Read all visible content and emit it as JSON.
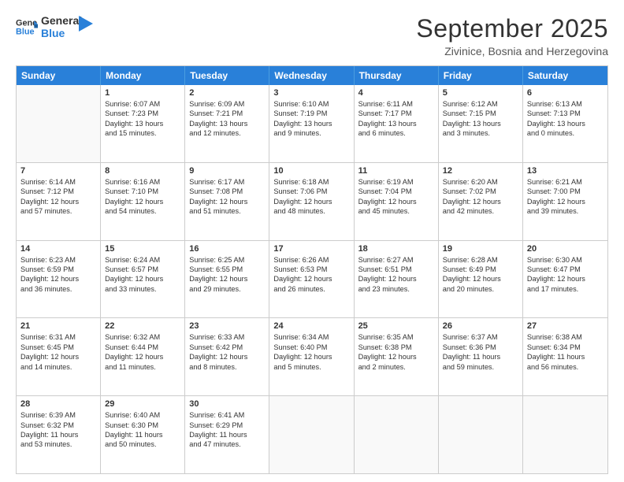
{
  "logo": {
    "line1": "General",
    "line2": "Blue"
  },
  "header": {
    "title": "September 2025",
    "subtitle": "Zivinice, Bosnia and Herzegovina"
  },
  "days": [
    "Sunday",
    "Monday",
    "Tuesday",
    "Wednesday",
    "Thursday",
    "Friday",
    "Saturday"
  ],
  "weeks": [
    [
      {
        "day": "",
        "lines": []
      },
      {
        "day": "1",
        "lines": [
          "Sunrise: 6:07 AM",
          "Sunset: 7:23 PM",
          "Daylight: 13 hours",
          "and 15 minutes."
        ]
      },
      {
        "day": "2",
        "lines": [
          "Sunrise: 6:09 AM",
          "Sunset: 7:21 PM",
          "Daylight: 13 hours",
          "and 12 minutes."
        ]
      },
      {
        "day": "3",
        "lines": [
          "Sunrise: 6:10 AM",
          "Sunset: 7:19 PM",
          "Daylight: 13 hours",
          "and 9 minutes."
        ]
      },
      {
        "day": "4",
        "lines": [
          "Sunrise: 6:11 AM",
          "Sunset: 7:17 PM",
          "Daylight: 13 hours",
          "and 6 minutes."
        ]
      },
      {
        "day": "5",
        "lines": [
          "Sunrise: 6:12 AM",
          "Sunset: 7:15 PM",
          "Daylight: 13 hours",
          "and 3 minutes."
        ]
      },
      {
        "day": "6",
        "lines": [
          "Sunrise: 6:13 AM",
          "Sunset: 7:13 PM",
          "Daylight: 13 hours",
          "and 0 minutes."
        ]
      }
    ],
    [
      {
        "day": "7",
        "lines": [
          "Sunrise: 6:14 AM",
          "Sunset: 7:12 PM",
          "Daylight: 12 hours",
          "and 57 minutes."
        ]
      },
      {
        "day": "8",
        "lines": [
          "Sunrise: 6:16 AM",
          "Sunset: 7:10 PM",
          "Daylight: 12 hours",
          "and 54 minutes."
        ]
      },
      {
        "day": "9",
        "lines": [
          "Sunrise: 6:17 AM",
          "Sunset: 7:08 PM",
          "Daylight: 12 hours",
          "and 51 minutes."
        ]
      },
      {
        "day": "10",
        "lines": [
          "Sunrise: 6:18 AM",
          "Sunset: 7:06 PM",
          "Daylight: 12 hours",
          "and 48 minutes."
        ]
      },
      {
        "day": "11",
        "lines": [
          "Sunrise: 6:19 AM",
          "Sunset: 7:04 PM",
          "Daylight: 12 hours",
          "and 45 minutes."
        ]
      },
      {
        "day": "12",
        "lines": [
          "Sunrise: 6:20 AM",
          "Sunset: 7:02 PM",
          "Daylight: 12 hours",
          "and 42 minutes."
        ]
      },
      {
        "day": "13",
        "lines": [
          "Sunrise: 6:21 AM",
          "Sunset: 7:00 PM",
          "Daylight: 12 hours",
          "and 39 minutes."
        ]
      }
    ],
    [
      {
        "day": "14",
        "lines": [
          "Sunrise: 6:23 AM",
          "Sunset: 6:59 PM",
          "Daylight: 12 hours",
          "and 36 minutes."
        ]
      },
      {
        "day": "15",
        "lines": [
          "Sunrise: 6:24 AM",
          "Sunset: 6:57 PM",
          "Daylight: 12 hours",
          "and 33 minutes."
        ]
      },
      {
        "day": "16",
        "lines": [
          "Sunrise: 6:25 AM",
          "Sunset: 6:55 PM",
          "Daylight: 12 hours",
          "and 29 minutes."
        ]
      },
      {
        "day": "17",
        "lines": [
          "Sunrise: 6:26 AM",
          "Sunset: 6:53 PM",
          "Daylight: 12 hours",
          "and 26 minutes."
        ]
      },
      {
        "day": "18",
        "lines": [
          "Sunrise: 6:27 AM",
          "Sunset: 6:51 PM",
          "Daylight: 12 hours",
          "and 23 minutes."
        ]
      },
      {
        "day": "19",
        "lines": [
          "Sunrise: 6:28 AM",
          "Sunset: 6:49 PM",
          "Daylight: 12 hours",
          "and 20 minutes."
        ]
      },
      {
        "day": "20",
        "lines": [
          "Sunrise: 6:30 AM",
          "Sunset: 6:47 PM",
          "Daylight: 12 hours",
          "and 17 minutes."
        ]
      }
    ],
    [
      {
        "day": "21",
        "lines": [
          "Sunrise: 6:31 AM",
          "Sunset: 6:45 PM",
          "Daylight: 12 hours",
          "and 14 minutes."
        ]
      },
      {
        "day": "22",
        "lines": [
          "Sunrise: 6:32 AM",
          "Sunset: 6:44 PM",
          "Daylight: 12 hours",
          "and 11 minutes."
        ]
      },
      {
        "day": "23",
        "lines": [
          "Sunrise: 6:33 AM",
          "Sunset: 6:42 PM",
          "Daylight: 12 hours",
          "and 8 minutes."
        ]
      },
      {
        "day": "24",
        "lines": [
          "Sunrise: 6:34 AM",
          "Sunset: 6:40 PM",
          "Daylight: 12 hours",
          "and 5 minutes."
        ]
      },
      {
        "day": "25",
        "lines": [
          "Sunrise: 6:35 AM",
          "Sunset: 6:38 PM",
          "Daylight: 12 hours",
          "and 2 minutes."
        ]
      },
      {
        "day": "26",
        "lines": [
          "Sunrise: 6:37 AM",
          "Sunset: 6:36 PM",
          "Daylight: 11 hours",
          "and 59 minutes."
        ]
      },
      {
        "day": "27",
        "lines": [
          "Sunrise: 6:38 AM",
          "Sunset: 6:34 PM",
          "Daylight: 11 hours",
          "and 56 minutes."
        ]
      }
    ],
    [
      {
        "day": "28",
        "lines": [
          "Sunrise: 6:39 AM",
          "Sunset: 6:32 PM",
          "Daylight: 11 hours",
          "and 53 minutes."
        ]
      },
      {
        "day": "29",
        "lines": [
          "Sunrise: 6:40 AM",
          "Sunset: 6:30 PM",
          "Daylight: 11 hours",
          "and 50 minutes."
        ]
      },
      {
        "day": "30",
        "lines": [
          "Sunrise: 6:41 AM",
          "Sunset: 6:29 PM",
          "Daylight: 11 hours",
          "and 47 minutes."
        ]
      },
      {
        "day": "",
        "lines": []
      },
      {
        "day": "",
        "lines": []
      },
      {
        "day": "",
        "lines": []
      },
      {
        "day": "",
        "lines": []
      }
    ]
  ]
}
